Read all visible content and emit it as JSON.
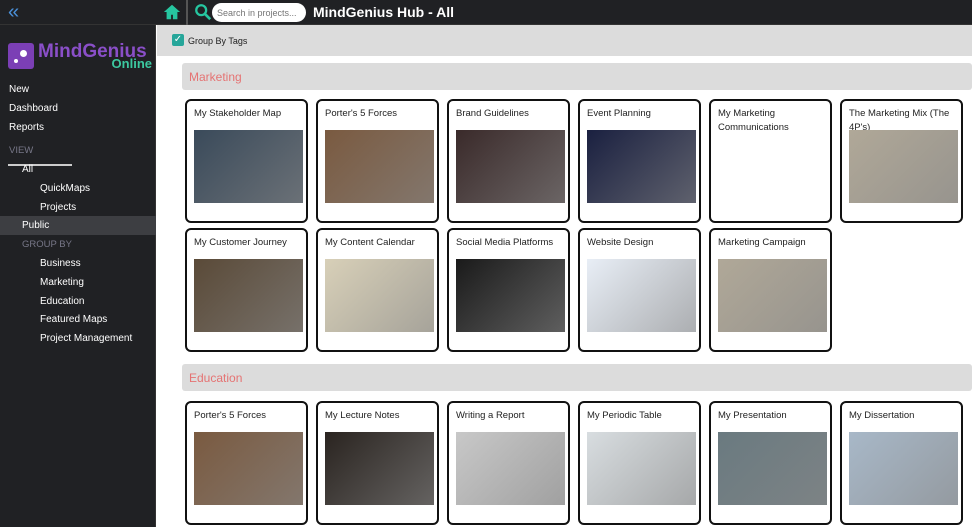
{
  "header": {
    "title": "MindGenius Hub - All",
    "search_placeholder": "Search in projects..."
  },
  "logo": {
    "text1": "MindGenius",
    "text2": "Online"
  },
  "sidebar": {
    "top": [
      "New",
      "Dashboard",
      "Reports"
    ],
    "view_label": "VIEW",
    "all": "All",
    "all_sub": [
      "QuickMaps",
      "Projects"
    ],
    "public": "Public",
    "group_label": "GROUP BY",
    "groups": [
      "Business",
      "Marketing",
      "Education",
      "Featured Maps",
      "Project Management"
    ]
  },
  "toolbar": {
    "group_by_tags": "Group By Tags",
    "checked": true
  },
  "groups": [
    {
      "name": "Marketing",
      "cards": [
        {
          "title": "My Stakeholder Map",
          "img": "#3a4a5a"
        },
        {
          "title": "Porter's 5 Forces",
          "img": "#7a5a40"
        },
        {
          "title": "Brand Guidelines",
          "img": "#3a2a2a"
        },
        {
          "title": "Event Planning",
          "img": "#1a2040"
        },
        {
          "title": "My Marketing Communications",
          "img": "#ffffff"
        },
        {
          "title": "The Marketing Mix (The 4P's)",
          "img": "#b0a898"
        },
        {
          "title": "My Customer Journey",
          "img": "#5a4a38"
        },
        {
          "title": "My Content Calendar",
          "img": "#d8d0b8"
        },
        {
          "title": "Social Media Platforms",
          "img": "#1a1a1a"
        },
        {
          "title": "Website Design",
          "img": "#e8eef6"
        },
        {
          "title": "Marketing Campaign",
          "img": "#b0a898"
        }
      ]
    },
    {
      "name": "Education",
      "cards": [
        {
          "title": "Porter's 5 Forces",
          "img": "#7a5a40"
        },
        {
          "title": "My Lecture Notes",
          "img": "#2a2420"
        },
        {
          "title": "Writing a Report",
          "img": "#c8c8c8"
        },
        {
          "title": "My Periodic Table",
          "img": "#d8dde0"
        },
        {
          "title": "My Presentation",
          "img": "#6a7a80"
        },
        {
          "title": "My Dissertation",
          "img": "#a8b8c8"
        }
      ]
    }
  ]
}
